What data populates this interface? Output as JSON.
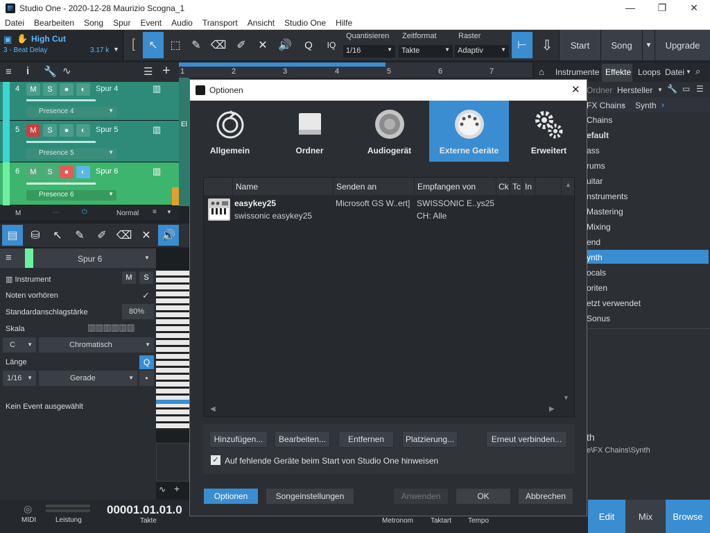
{
  "window": {
    "title": "Studio One - 2020-12-28 Maurizio Scogna_1",
    "min": "—",
    "restore": "❐",
    "close": "✕"
  },
  "menu": [
    "Datei",
    "Bearbeiten",
    "Song",
    "Spur",
    "Event",
    "Audio",
    "Transport",
    "Ansicht",
    "Studio One",
    "Hilfe"
  ],
  "toolbar": {
    "instrument_name": "High Cut",
    "instrument_sub": "3 - Beat Delay",
    "instrument_value": "3.17 k",
    "quantize_label": "Quantisieren",
    "quantize_value": "1/16",
    "timeformat_label": "Zeitformat",
    "timeformat_value": "Takte",
    "grid_label": "Raster",
    "grid_value": "Adaptiv",
    "iq_label": "IQ",
    "q_label": "Q",
    "start_label": "Start",
    "song_label": "Song",
    "upgrade_label": "Upgrade"
  },
  "ruler": [
    "1",
    "2",
    "3",
    "4",
    "5",
    "6",
    "7"
  ],
  "tracks": [
    {
      "num": "4",
      "name": "Spur 4",
      "preset": "Presence 4",
      "m": "M",
      "s": "S"
    },
    {
      "num": "5",
      "name": "Spur 5",
      "preset": "Presence 5",
      "m": "M",
      "s": "S"
    },
    {
      "num": "6",
      "name": "Spur 6",
      "preset": "Presence 6",
      "m": "M",
      "s": "S"
    }
  ],
  "track_footer": {
    "m": "M",
    "mode": "Normal"
  },
  "inspector": {
    "track": "Spur 6",
    "instrument": "Instrument",
    "m": "M",
    "s": "S",
    "preview": "Noten vorhören",
    "velocity_label": "Standardanschlagstärke",
    "velocity_value": "80%",
    "scale_label": "Skala",
    "key": "C",
    "scale": "Chromatisch",
    "length_label": "Länge",
    "q": "Q",
    "length_value": "1/16",
    "length_mode": "Gerade",
    "no_event": "Kein Event ausgewählt"
  },
  "right_panel": {
    "tabs": [
      "Instrumente",
      "Effekte",
      "Loops",
      "Datei"
    ],
    "sort": [
      "Ordner",
      "Hersteller"
    ],
    "breadcrumb": [
      "FX Chains",
      "Synth"
    ],
    "items": [
      "Chains",
      "efault",
      "ass",
      "rums",
      "uitar",
      "nstruments",
      "Mastering",
      "Mixing",
      "end",
      "ynth",
      "ocals",
      "oriten",
      "etzt verwendet",
      "Sonus"
    ],
    "selected": "ynth",
    "footer_title": "th",
    "footer_path": "e\\FX Chains\\Synth"
  },
  "bottom": {
    "midi": "MIDI",
    "perf": "Leistung",
    "time": "00001.01.01.0",
    "time_label": "Takte",
    "metronom": "Metronom",
    "taktart": "Taktart",
    "tempo": "Tempo",
    "edit": "Edit",
    "mix": "Mix",
    "browse": "Browse"
  },
  "dialog": {
    "title": "Optionen",
    "close": "✕",
    "categories": [
      "Allgemein",
      "Ordner",
      "Audiogerät",
      "Externe Geräte",
      "Erweitert"
    ],
    "active_category": "Externe Geräte",
    "columns": [
      "Name",
      "Senden an",
      "Empfangen von",
      "Ck",
      "Tc",
      "In"
    ],
    "devices": [
      {
        "name": "easykey25",
        "sub": "swissonic easykey25",
        "send": "Microsoft GS W..ert]",
        "receive": "SWISSONIC E..ys25",
        "receive_ch": "CH: Alle"
      }
    ],
    "buttons": {
      "add": "Hinzufügen...",
      "edit": "Bearbeiten...",
      "remove": "Entfernen",
      "place": "Platzierung...",
      "reconnect": "Erneut verbinden..."
    },
    "checkbox_label": "Auf fehlende Geräte beim Start von Studio One hinweisen",
    "footer": {
      "options": "Optionen",
      "song": "Songeinstellungen",
      "apply": "Anwenden",
      "ok": "OK",
      "cancel": "Abbrechen"
    }
  }
}
